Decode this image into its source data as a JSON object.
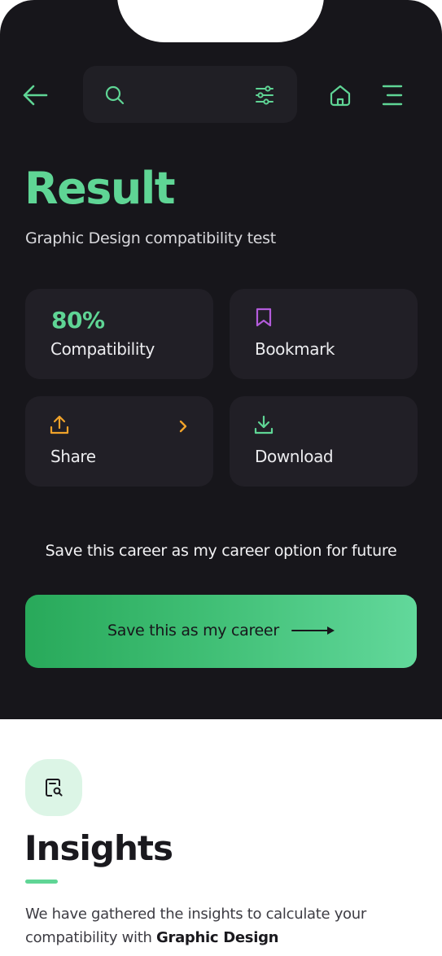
{
  "header": {
    "back_icon": "arrow-left-icon",
    "search_icon": "search-icon",
    "filter_icon": "sliders-icon",
    "home_icon": "home-icon",
    "menu_icon": "menu-icon"
  },
  "result": {
    "title": "Result",
    "subtitle": "Graphic Design compatibility test"
  },
  "cards": {
    "compatibility": {
      "value": "80%",
      "label": "Compatibility"
    },
    "bookmark": {
      "label": "Bookmark",
      "icon": "bookmark-icon"
    },
    "share": {
      "label": "Share",
      "icon": "upload-icon",
      "chevron_icon": "chevron-right-icon"
    },
    "download": {
      "label": "Download",
      "icon": "download-icon"
    }
  },
  "save": {
    "prompt": "Save this career as my career option for future",
    "button_label": "Save this as my career"
  },
  "insights": {
    "icon": "document-search-icon",
    "title": "Insights",
    "description_prefix": "We have gathered the insights to calculate your compatibility with",
    "description_bold": "Graphic Design"
  },
  "colors": {
    "background_dark": "#17161b",
    "card": "#211f26",
    "accent_green": "#5fd595",
    "accent_orange": "#f0a22a",
    "accent_purple": "#b45cdc",
    "badge_bg": "#dcf5e6"
  }
}
